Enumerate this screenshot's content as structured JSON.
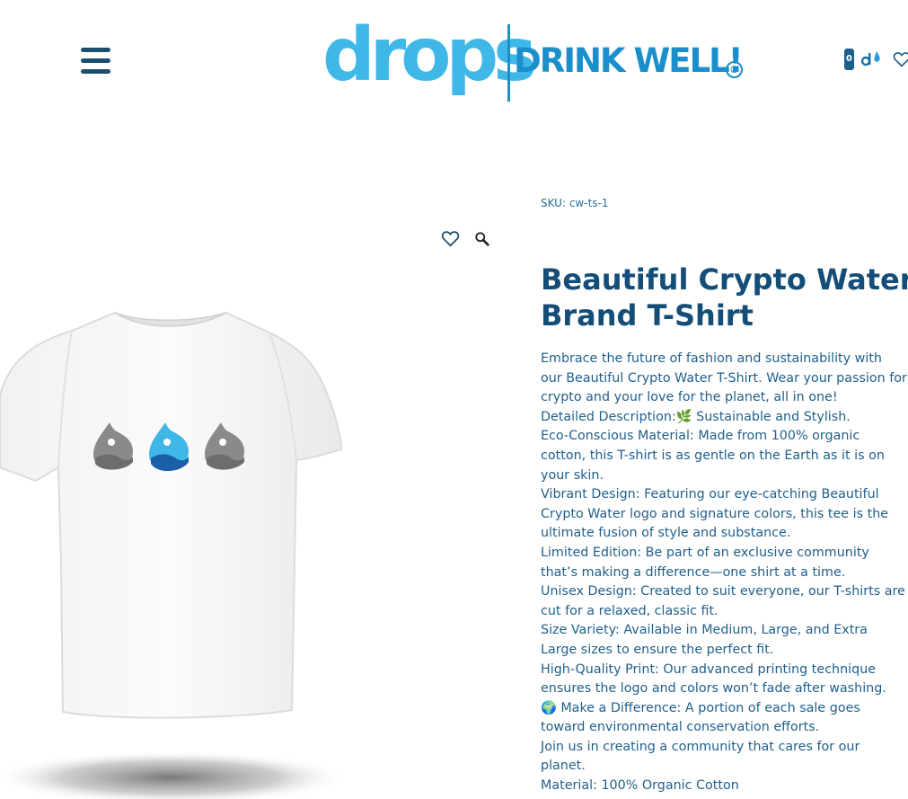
{
  "header": {
    "logo_drops": "drops",
    "logo_tagline": "DRINK WELL!",
    "logo_reg": "®",
    "cart_count": "0",
    "menu_icon": "hamburger-menu-icon",
    "cart_icon": "drops-cart-icon",
    "wishlist_icon": "heart-icon"
  },
  "gallery": {
    "wishlist_icon": "heart-outline-icon",
    "zoom_icon": "magnifier-icon",
    "image": "white t-shirt with three water-drop logos"
  },
  "product": {
    "sku_label": "SKU:",
    "sku_value": "cw-ts-1",
    "title": "Beautiful Crypto Water Brand T-Shirt",
    "description_lines": [
      "Embrace the future of fashion and sustainability with our Beautiful Crypto Water T-Shirt. Wear your passion for crypto and your love for the planet, all in one!",
      "Detailed Description:🌿 Sustainable and Stylish.",
      "Eco-Conscious Material: Made from 100% organic cotton, this T-shirt is as gentle on the Earth as it is on your skin.",
      "Vibrant Design: Featuring our eye-catching Beautiful Crypto Water logo and signature colors, this tee is the ultimate fusion of style and substance.",
      "Limited Edition: Be part of an exclusive community that’s making a difference—one shirt at a time.",
      "Unisex Design: Created to suit everyone, our T-shirts are cut for a relaxed, classic fit.",
      "Size Variety: Available in Medium, Large, and Extra Large sizes to ensure the perfect fit.",
      "High-Quality Print: Our advanced printing technique ensures the logo and colors won’t fade after washing.",
      "🌍 Make a Difference: A portion of each sale goes toward environmental conservation efforts.",
      "Join us in creating a community that cares for our planet.",
      "Material: 100% Organic Cotton"
    ]
  },
  "colors": {
    "title": "#134d78",
    "body_text": "#1f5f8b",
    "logo_light_blue": "#3fb8e8",
    "logo_blue": "#1b8fcc",
    "menu_navy": "#1b4d6e"
  }
}
